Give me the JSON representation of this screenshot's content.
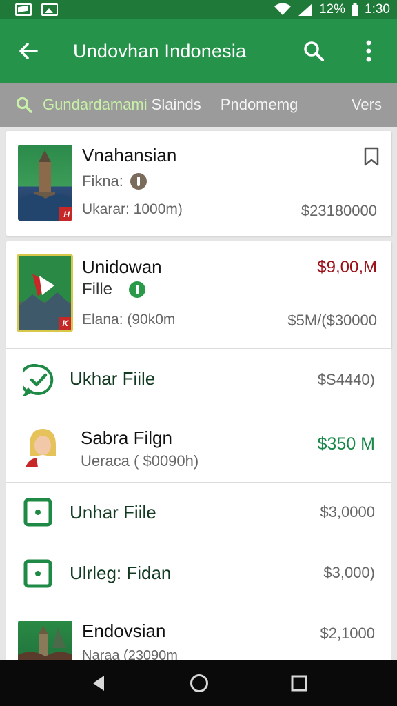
{
  "status_bar": {
    "battery_text": "12%",
    "time": "1:30"
  },
  "app_bar": {
    "title": "Undovhan Indonesia"
  },
  "tabs": [
    "Gundardamami",
    "Slainds",
    "Pndomemg",
    "Vers"
  ],
  "cards": [
    {
      "name": "Vnahansian",
      "sub": "Fikna:",
      "meta": "Ukarar: 1000m)",
      "price": "$23180000",
      "thumb_badge": "H"
    },
    {
      "name": "Unidowan",
      "sub": "Fille",
      "meta": "Elana: (90k0m",
      "price_main": "$9,00,M",
      "price_range": "$5M/($30000",
      "thumb_badge": "K"
    }
  ],
  "rows": [
    {
      "name": "Ukhar Fiile",
      "price": "$S4440)"
    },
    {
      "name": "Sabra Filgn",
      "sub": "Ueraca ( $0090h)",
      "price": "$350 M"
    },
    {
      "name": "Unhar Fiile",
      "price": "$3,0000"
    },
    {
      "name": "Ulrleg: Fidan",
      "price": "$3,000)"
    },
    {
      "name": "Endovsian",
      "sub": "Naraa (23090m",
      "price": "$2,1000"
    }
  ],
  "colors": {
    "status_bar": "#1f7a3a",
    "app_bar": "#25934a",
    "tab_bar": "#9a9b9a",
    "accent_green": "#18894a",
    "accent_red": "#9b1118"
  }
}
